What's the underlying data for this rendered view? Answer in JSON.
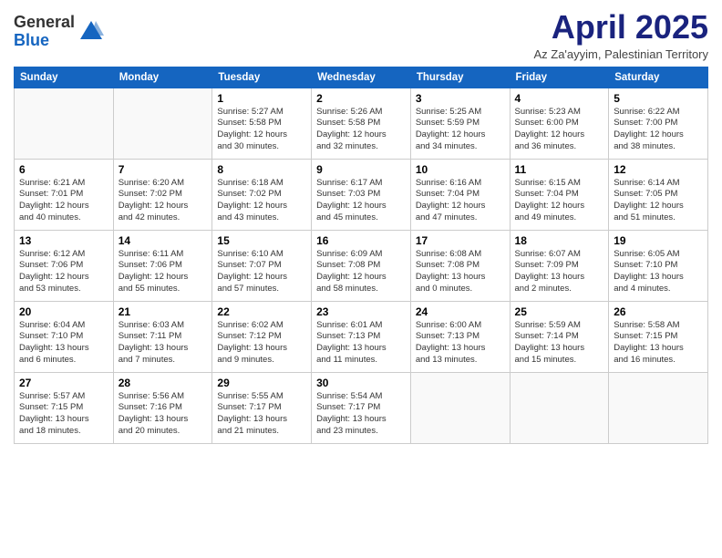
{
  "header": {
    "logo_general": "General",
    "logo_blue": "Blue",
    "month_title": "April 2025",
    "subtitle": "Az Za'ayyim, Palestinian Territory"
  },
  "days_of_week": [
    "Sunday",
    "Monday",
    "Tuesday",
    "Wednesday",
    "Thursday",
    "Friday",
    "Saturday"
  ],
  "weeks": [
    [
      {
        "day": "",
        "info": ""
      },
      {
        "day": "",
        "info": ""
      },
      {
        "day": "1",
        "info": "Sunrise: 5:27 AM\nSunset: 5:58 PM\nDaylight: 12 hours\nand 30 minutes."
      },
      {
        "day": "2",
        "info": "Sunrise: 5:26 AM\nSunset: 5:58 PM\nDaylight: 12 hours\nand 32 minutes."
      },
      {
        "day": "3",
        "info": "Sunrise: 5:25 AM\nSunset: 5:59 PM\nDaylight: 12 hours\nand 34 minutes."
      },
      {
        "day": "4",
        "info": "Sunrise: 5:23 AM\nSunset: 6:00 PM\nDaylight: 12 hours\nand 36 minutes."
      },
      {
        "day": "5",
        "info": "Sunrise: 6:22 AM\nSunset: 7:00 PM\nDaylight: 12 hours\nand 38 minutes."
      }
    ],
    [
      {
        "day": "6",
        "info": "Sunrise: 6:21 AM\nSunset: 7:01 PM\nDaylight: 12 hours\nand 40 minutes."
      },
      {
        "day": "7",
        "info": "Sunrise: 6:20 AM\nSunset: 7:02 PM\nDaylight: 12 hours\nand 42 minutes."
      },
      {
        "day": "8",
        "info": "Sunrise: 6:18 AM\nSunset: 7:02 PM\nDaylight: 12 hours\nand 43 minutes."
      },
      {
        "day": "9",
        "info": "Sunrise: 6:17 AM\nSunset: 7:03 PM\nDaylight: 12 hours\nand 45 minutes."
      },
      {
        "day": "10",
        "info": "Sunrise: 6:16 AM\nSunset: 7:04 PM\nDaylight: 12 hours\nand 47 minutes."
      },
      {
        "day": "11",
        "info": "Sunrise: 6:15 AM\nSunset: 7:04 PM\nDaylight: 12 hours\nand 49 minutes."
      },
      {
        "day": "12",
        "info": "Sunrise: 6:14 AM\nSunset: 7:05 PM\nDaylight: 12 hours\nand 51 minutes."
      }
    ],
    [
      {
        "day": "13",
        "info": "Sunrise: 6:12 AM\nSunset: 7:06 PM\nDaylight: 12 hours\nand 53 minutes."
      },
      {
        "day": "14",
        "info": "Sunrise: 6:11 AM\nSunset: 7:06 PM\nDaylight: 12 hours\nand 55 minutes."
      },
      {
        "day": "15",
        "info": "Sunrise: 6:10 AM\nSunset: 7:07 PM\nDaylight: 12 hours\nand 57 minutes."
      },
      {
        "day": "16",
        "info": "Sunrise: 6:09 AM\nSunset: 7:08 PM\nDaylight: 12 hours\nand 58 minutes."
      },
      {
        "day": "17",
        "info": "Sunrise: 6:08 AM\nSunset: 7:08 PM\nDaylight: 13 hours\nand 0 minutes."
      },
      {
        "day": "18",
        "info": "Sunrise: 6:07 AM\nSunset: 7:09 PM\nDaylight: 13 hours\nand 2 minutes."
      },
      {
        "day": "19",
        "info": "Sunrise: 6:05 AM\nSunset: 7:10 PM\nDaylight: 13 hours\nand 4 minutes."
      }
    ],
    [
      {
        "day": "20",
        "info": "Sunrise: 6:04 AM\nSunset: 7:10 PM\nDaylight: 13 hours\nand 6 minutes."
      },
      {
        "day": "21",
        "info": "Sunrise: 6:03 AM\nSunset: 7:11 PM\nDaylight: 13 hours\nand 7 minutes."
      },
      {
        "day": "22",
        "info": "Sunrise: 6:02 AM\nSunset: 7:12 PM\nDaylight: 13 hours\nand 9 minutes."
      },
      {
        "day": "23",
        "info": "Sunrise: 6:01 AM\nSunset: 7:13 PM\nDaylight: 13 hours\nand 11 minutes."
      },
      {
        "day": "24",
        "info": "Sunrise: 6:00 AM\nSunset: 7:13 PM\nDaylight: 13 hours\nand 13 minutes."
      },
      {
        "day": "25",
        "info": "Sunrise: 5:59 AM\nSunset: 7:14 PM\nDaylight: 13 hours\nand 15 minutes."
      },
      {
        "day": "26",
        "info": "Sunrise: 5:58 AM\nSunset: 7:15 PM\nDaylight: 13 hours\nand 16 minutes."
      }
    ],
    [
      {
        "day": "27",
        "info": "Sunrise: 5:57 AM\nSunset: 7:15 PM\nDaylight: 13 hours\nand 18 minutes."
      },
      {
        "day": "28",
        "info": "Sunrise: 5:56 AM\nSunset: 7:16 PM\nDaylight: 13 hours\nand 20 minutes."
      },
      {
        "day": "29",
        "info": "Sunrise: 5:55 AM\nSunset: 7:17 PM\nDaylight: 13 hours\nand 21 minutes."
      },
      {
        "day": "30",
        "info": "Sunrise: 5:54 AM\nSunset: 7:17 PM\nDaylight: 13 hours\nand 23 minutes."
      },
      {
        "day": "",
        "info": ""
      },
      {
        "day": "",
        "info": ""
      },
      {
        "day": "",
        "info": ""
      }
    ]
  ]
}
